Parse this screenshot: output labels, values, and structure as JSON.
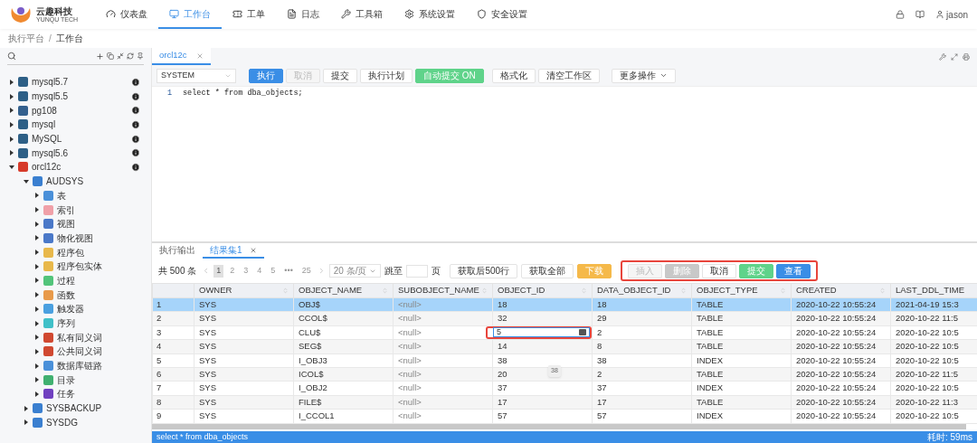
{
  "brand": {
    "name": "云趣科技",
    "tagline": "YUNQU TECH"
  },
  "nav": [
    {
      "label": "仪表盘",
      "selected": false
    },
    {
      "label": "工作台",
      "selected": true
    },
    {
      "label": "工单",
      "selected": false
    },
    {
      "label": "日志",
      "selected": false
    },
    {
      "label": "工具箱",
      "selected": false
    },
    {
      "label": "系统设置",
      "selected": false
    },
    {
      "label": "安全设置",
      "selected": false
    }
  ],
  "user": {
    "name": "jason"
  },
  "breadcrumb": [
    "执行平台",
    "工作台"
  ],
  "breadcrumb_separator": "/",
  "tree": [
    {
      "label": "mysql5.7",
      "kind": "mysql",
      "expanded": false,
      "info": true
    },
    {
      "label": "mysql5.5",
      "kind": "mysql",
      "expanded": false,
      "info": true
    },
    {
      "label": "pg108",
      "kind": "pg",
      "expanded": false,
      "info": true
    },
    {
      "label": "mysql",
      "kind": "mysql",
      "expanded": false,
      "info": true
    },
    {
      "label": "MySQL",
      "kind": "mysql",
      "expanded": false,
      "info": true
    },
    {
      "label": "mysql5.6",
      "kind": "mysql",
      "expanded": false,
      "info": true
    },
    {
      "label": "orcl12c",
      "kind": "oracle",
      "expanded": true,
      "info": true,
      "children": [
        {
          "label": "AUDSYS",
          "kind": "schema",
          "expanded": true,
          "children": [
            {
              "label": "表",
              "kind": "table",
              "expanded": false
            },
            {
              "label": "索引",
              "kind": "index",
              "expanded": false
            },
            {
              "label": "视图",
              "kind": "view",
              "expanded": false
            },
            {
              "label": "物化视图",
              "kind": "view",
              "expanded": false
            },
            {
              "label": "程序包",
              "kind": "package",
              "expanded": false
            },
            {
              "label": "程序包实体",
              "kind": "package",
              "expanded": false
            },
            {
              "label": "过程",
              "kind": "procedure",
              "expanded": false
            },
            {
              "label": "函数",
              "kind": "function",
              "expanded": false
            },
            {
              "label": "触发器",
              "kind": "trigger",
              "expanded": false
            },
            {
              "label": "序列",
              "kind": "sequence",
              "expanded": false
            },
            {
              "label": "私有同义词",
              "kind": "synonym",
              "expanded": false
            },
            {
              "label": "公共同义词",
              "kind": "synonym",
              "expanded": false
            },
            {
              "label": "数据库链路",
              "kind": "link",
              "expanded": false
            },
            {
              "label": "目录",
              "kind": "directory",
              "expanded": false
            },
            {
              "label": "任务",
              "kind": "job",
              "expanded": false
            }
          ]
        },
        {
          "label": "SYSBACKUP",
          "kind": "schema",
          "expanded": false
        },
        {
          "label": "SYSDG",
          "kind": "schema",
          "expanded": false
        }
      ]
    }
  ],
  "editor": {
    "tabs": [
      {
        "label": "orcl12c",
        "selected": true
      }
    ],
    "schema": "SYSTEM",
    "buttons": [
      {
        "label": "执行",
        "kind": "primary"
      },
      {
        "label": "取消",
        "kind": "disabled"
      },
      {
        "label": "提交",
        "kind": "default"
      },
      {
        "label": "执行计划",
        "kind": "default"
      },
      {
        "label": "自动提交 ON",
        "kind": "success"
      },
      {
        "label": "格式化",
        "kind": "default"
      },
      {
        "label": "清空工作区",
        "kind": "default"
      },
      {
        "label": "更多操作",
        "kind": "dropdown"
      }
    ],
    "lines": [
      {
        "number": "1",
        "code": "select * from dba_objects;"
      }
    ]
  },
  "results": {
    "tabs": [
      {
        "label": "执行输出",
        "selected": false,
        "closable": false
      },
      {
        "label": "结果集1",
        "selected": true,
        "closable": true
      }
    ],
    "total": "共 500 条",
    "pages": [
      {
        "label": "1",
        "selected": true
      },
      {
        "label": "2",
        "selected": false
      },
      {
        "label": "3",
        "selected": false
      },
      {
        "label": "4",
        "selected": false
      },
      {
        "label": "5",
        "selected": false
      },
      {
        "label": "•••",
        "selected": false
      },
      {
        "label": "25",
        "selected": false
      }
    ],
    "page_size": "20 条/页",
    "jump_label": "跳至",
    "page_suffix": "页",
    "fetch_buttons": [
      {
        "label": "获取后500行",
        "kind": "default"
      },
      {
        "label": "获取全部",
        "kind": "default"
      },
      {
        "label": "下载",
        "kind": "warning"
      }
    ],
    "edit_buttons": [
      {
        "label": "插入",
        "kind": "disabled"
      },
      {
        "label": "删除",
        "kind": "muted"
      },
      {
        "label": "取消",
        "kind": "default"
      },
      {
        "label": "提交",
        "kind": "success"
      },
      {
        "label": "查看",
        "kind": "primary"
      }
    ],
    "columns": [
      {
        "label": "OWNER",
        "sortable": true
      },
      {
        "label": "OBJECT_NAME",
        "sortable": true
      },
      {
        "label": "SUBOBJECT_NAME",
        "sortable": true,
        "nulls": true
      },
      {
        "label": "OBJECT_ID",
        "sortable": true,
        "editing": true
      },
      {
        "label": "DATA_OBJECT_ID",
        "sortable": true
      },
      {
        "label": "OBJECT_TYPE",
        "sortable": true
      },
      {
        "label": "CREATED",
        "sortable": true
      },
      {
        "label": "LAST_DDL_TIME",
        "sortable": false
      }
    ],
    "rows": [
      {
        "number": "1",
        "selected": true,
        "editing": false,
        "cells": [
          "SYS",
          "OBJ$",
          "<null>",
          "18",
          "18",
          "TABLE",
          "2020-10-22 10:55:24",
          "2021-04-19 15:3"
        ]
      },
      {
        "number": "2",
        "selected": false,
        "editing": false,
        "cells": [
          "SYS",
          "CCOL$",
          "<null>",
          "32",
          "29",
          "TABLE",
          "2020-10-22 10:55:24",
          "2020-10-22 11:5"
        ]
      },
      {
        "number": "3",
        "selected": false,
        "editing": true,
        "cells": [
          "SYS",
          "CLU$",
          "<null>",
          "5",
          "2",
          "TABLE",
          "2020-10-22 10:55:24",
          "2020-10-22 10:5"
        ]
      },
      {
        "number": "4",
        "selected": false,
        "editing": false,
        "cells": [
          "SYS",
          "SEG$",
          "<null>",
          "14",
          "8",
          "TABLE",
          "2020-10-22 10:55:24",
          "2020-10-22 10:5"
        ]
      },
      {
        "number": "5",
        "selected": false,
        "editing": false,
        "cells": [
          "SYS",
          "I_OBJ3",
          "<null>",
          "38",
          "38",
          "INDEX",
          "2020-10-22 10:55:24",
          "2020-10-22 10:5"
        ]
      },
      {
        "number": "6",
        "selected": false,
        "editing": false,
        "cells": [
          "SYS",
          "ICOL$",
          "<null>",
          "20",
          "2",
          "TABLE",
          "2020-10-22 10:55:24",
          "2020-10-22 11:5"
        ]
      },
      {
        "number": "7",
        "selected": false,
        "editing": false,
        "cells": [
          "SYS",
          "I_OBJ2",
          "<null>",
          "37",
          "37",
          "INDEX",
          "2020-10-22 10:55:24",
          "2020-10-22 10:5"
        ]
      },
      {
        "number": "8",
        "selected": false,
        "editing": false,
        "cells": [
          "SYS",
          "FILE$",
          "<null>",
          "17",
          "17",
          "TABLE",
          "2020-10-22 10:55:24",
          "2020-10-22 11:3"
        ]
      },
      {
        "number": "9",
        "selected": false,
        "editing": false,
        "cells": [
          "SYS",
          "I_CCOL1",
          "<null>",
          "57",
          "57",
          "INDEX",
          "2020-10-22 10:55:24",
          "2020-10-22 10:5"
        ]
      }
    ],
    "tooltip": "38"
  },
  "status": {
    "sql": "select * from dba_objects",
    "elapsed": "耗时: 59ms"
  }
}
